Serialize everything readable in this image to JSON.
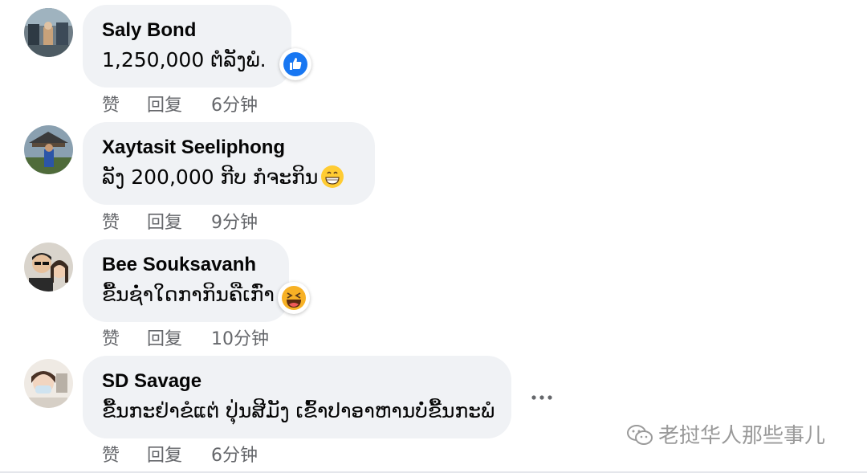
{
  "comments": [
    {
      "author": "Saly Bond",
      "text": "1,250,000 ຕໍລັງພໍ.",
      "reaction": "like-icon",
      "actions": {
        "like": "赞",
        "reply": "回复",
        "time": "6分钟"
      }
    },
    {
      "author": "Xaytasit Seeliphong",
      "text": "ລັງ 200,000 ກີບ ກໍຈະກິນ",
      "emoji": "grinning-face-icon",
      "actions": {
        "like": "赞",
        "reply": "回复",
        "time": "9分钟"
      }
    },
    {
      "author": "Bee Souksavanh",
      "text": "ຂື້ນຊໍ່າໃດກາກິນຄືເກົ່າ",
      "emoji": "laughing-face-icon",
      "actions": {
        "like": "赞",
        "reply": "回复",
        "time": "10分钟"
      }
    },
    {
      "author": "SD Savage",
      "text": "ຂື້ນກະຢ່າຂໍແຕ່ ປຸ່ນສີມັງ ເຂົ້າປາອາຫານບໍ່ຂື້ນກະພໍ",
      "actions": {
        "like": "赞",
        "reply": "回复",
        "time": "6分钟"
      }
    }
  ],
  "watermark": {
    "icon": "wechat-icon",
    "text": "老挝华人那些事儿"
  },
  "colors": {
    "bubble": "#f0f2f5",
    "meta": "#65676b",
    "like_blue": "#1877f2"
  }
}
